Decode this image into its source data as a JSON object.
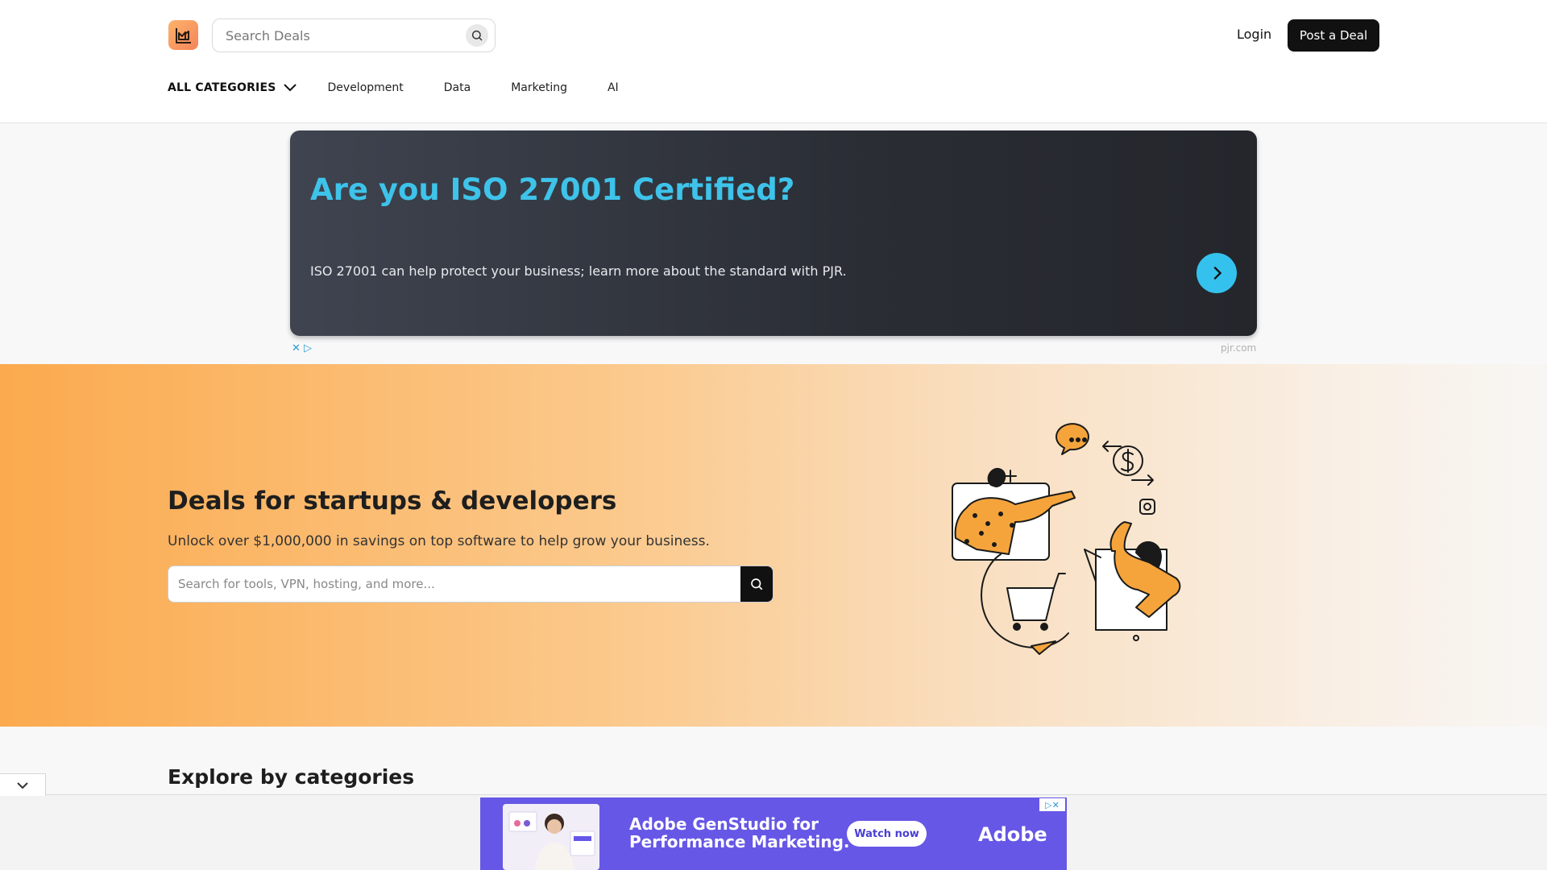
{
  "header": {
    "search_placeholder": "Search Deals",
    "login_label": "Login",
    "post_deal_label": "Post a Deal"
  },
  "nav": {
    "all_categories": "ALL CATEGORIES",
    "items": [
      "Development",
      "Data",
      "Marketing",
      "AI"
    ]
  },
  "ad_top": {
    "headline": "Are you ISO 27001 Certified?",
    "body": "ISO 27001 can help protect your business; learn more about the standard with PJR.",
    "domain": "pjr.com",
    "adchoices": "✕ ▷"
  },
  "hero": {
    "title": "Deals for startups & developers",
    "subtitle": "Unlock over $1,000,000 in savings on top software to help grow your business.",
    "search_placeholder": "Search for tools, VPN, hosting, and more..."
  },
  "categories": {
    "heading": "Explore by categories"
  },
  "ad_bottom": {
    "headline_line1": "Adobe GenStudio for",
    "headline_line2": "Performance Marketing.",
    "cta": "Watch now",
    "brand": "Adobe",
    "adchoices": "▷✕"
  },
  "colors": {
    "accent_blue": "#35c1ed",
    "hero_orange": "#fbaa4e",
    "ad_purple": "#6657e6"
  }
}
